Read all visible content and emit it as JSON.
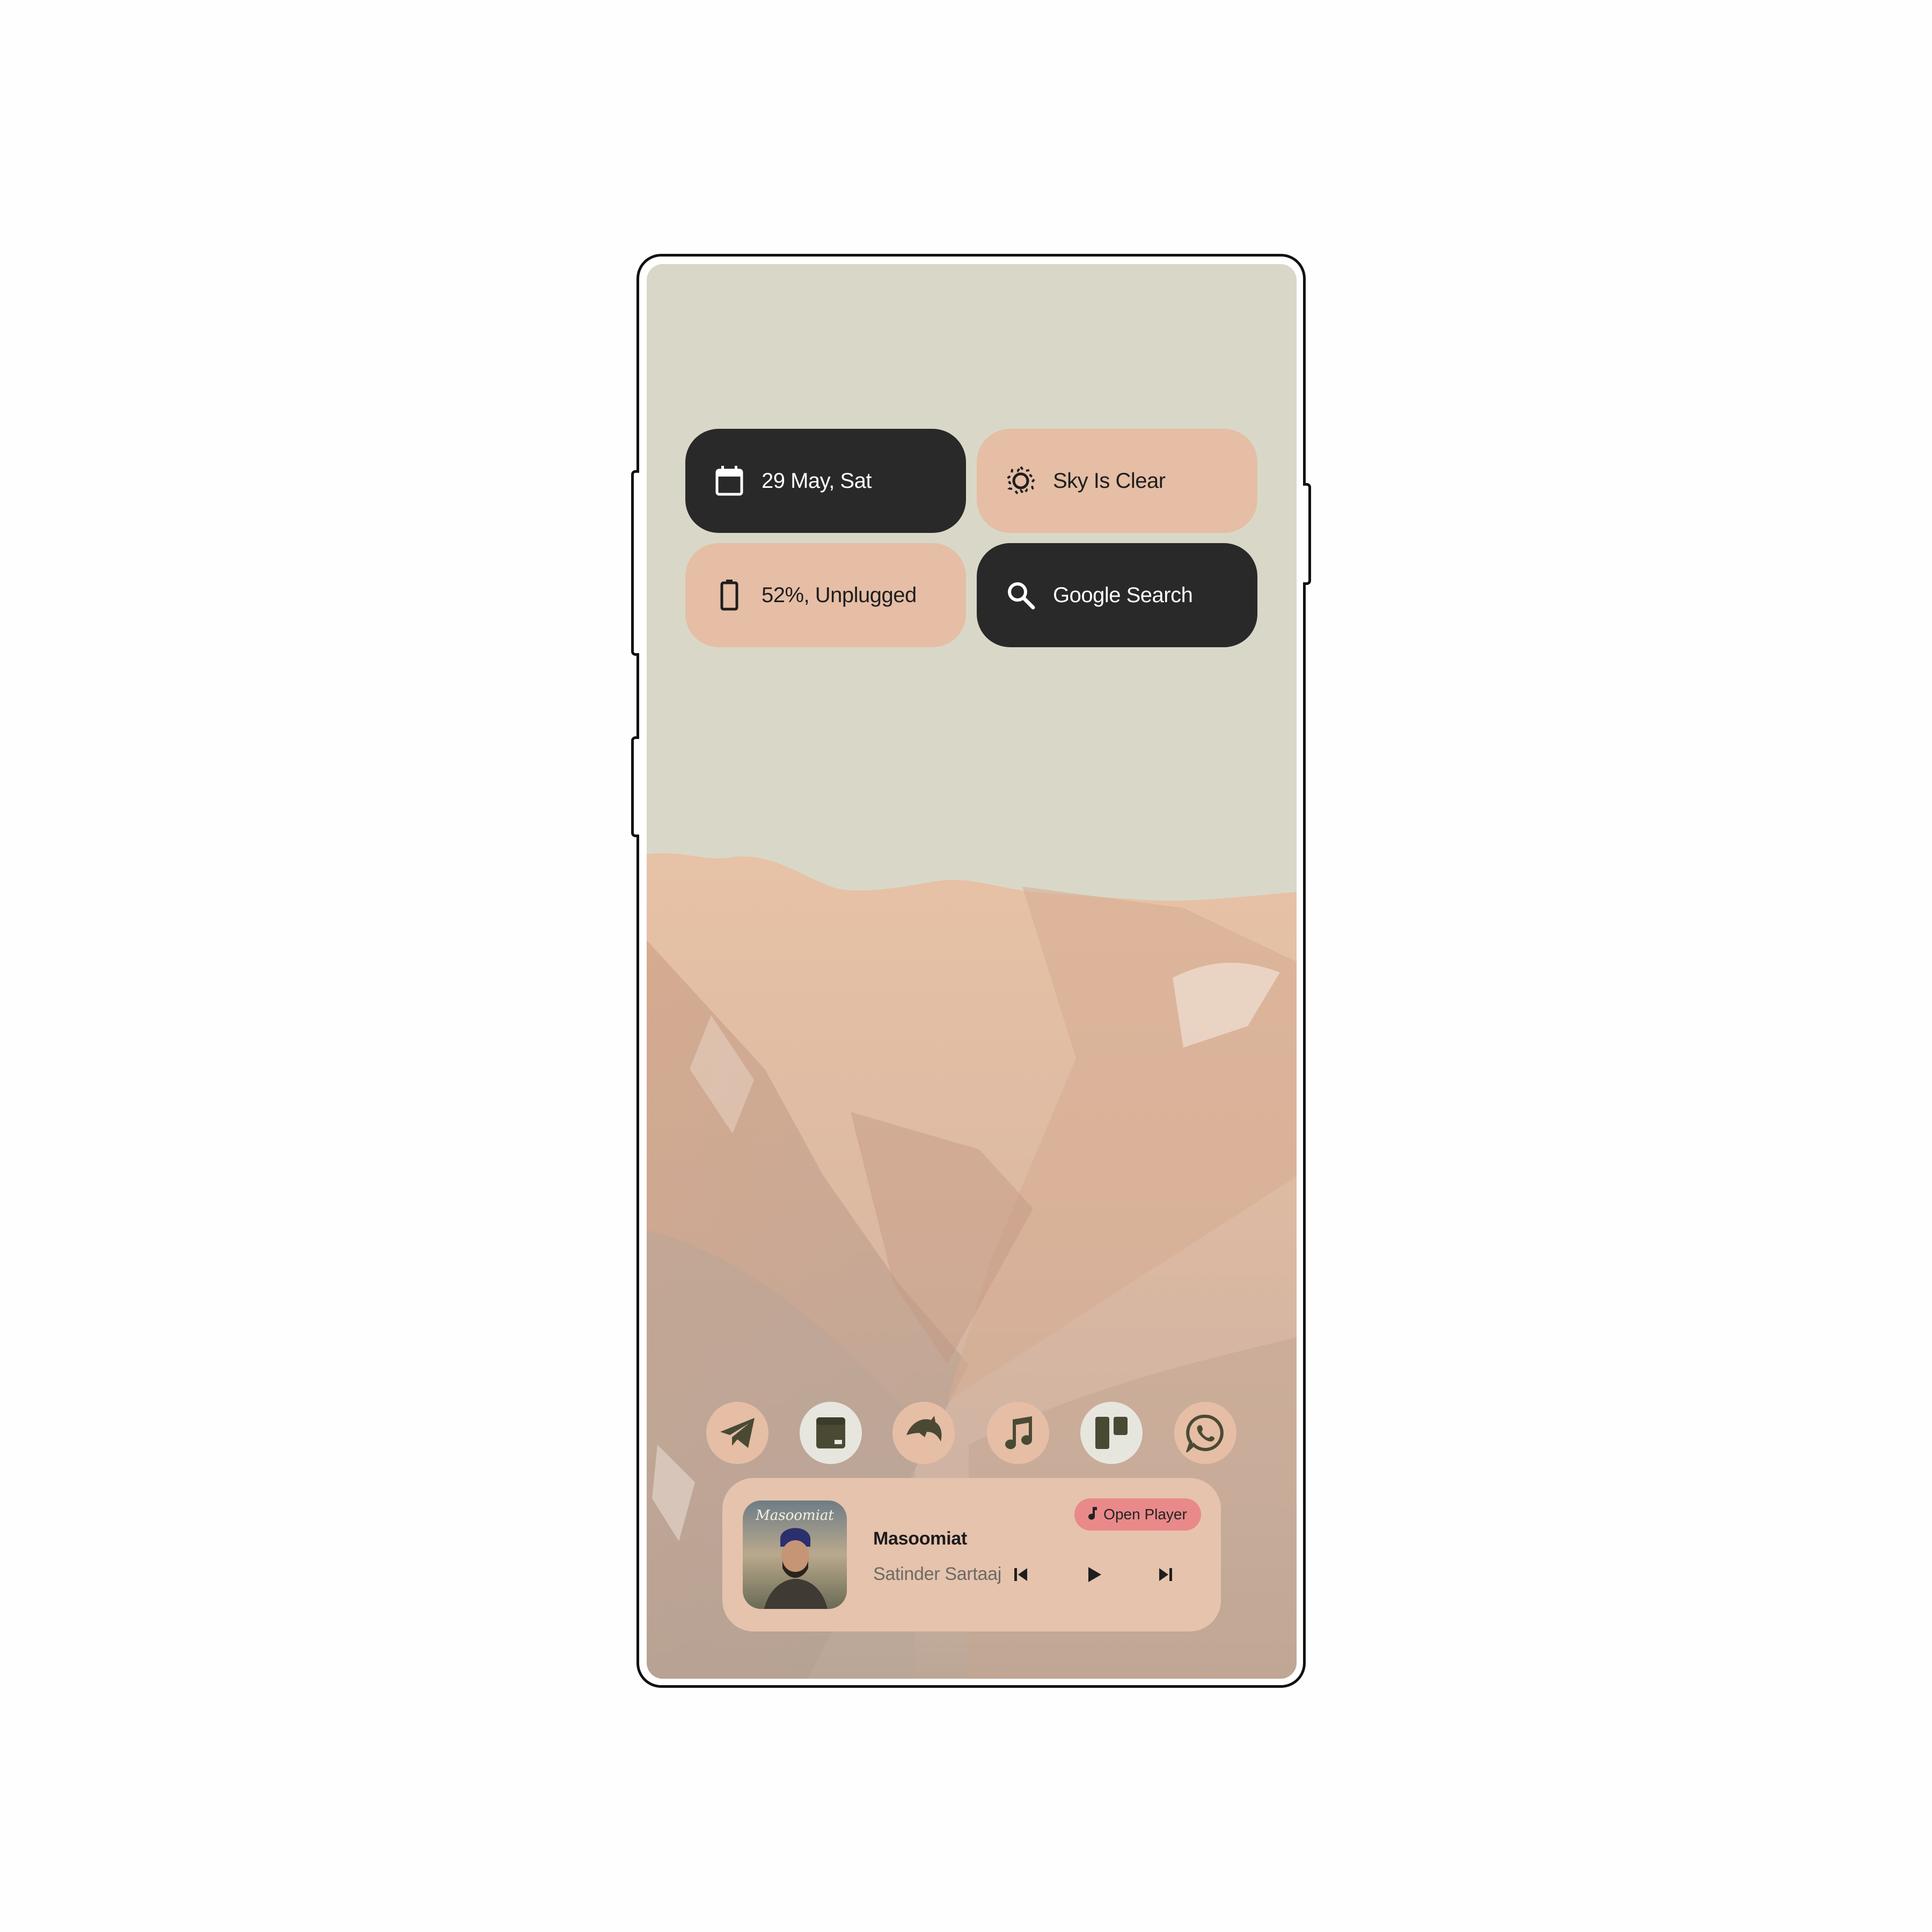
{
  "widgets": {
    "date": {
      "label": "29 May, Sat",
      "icon": "calendar-icon"
    },
    "weather": {
      "label": "Sky Is Clear",
      "icon": "brightness-icon"
    },
    "battery": {
      "label": "52%, Unplugged",
      "icon": "battery-icon"
    },
    "search": {
      "label": "Google Search",
      "icon": "search-icon"
    }
  },
  "dock": [
    {
      "icon": "telegram-icon"
    },
    {
      "icon": "notes-app-icon"
    },
    {
      "icon": "dolphin-icon"
    },
    {
      "icon": "music-note-icon"
    },
    {
      "icon": "trello-icon"
    },
    {
      "icon": "whatsapp-icon"
    }
  ],
  "player": {
    "title": "Masoomiat",
    "artist": "Satinder Sartaaj",
    "open_label": "Open Player",
    "cover_text": "Masoomiat"
  },
  "colors": {
    "dark_widget": "#292929",
    "peach_widget": "#e5bea5",
    "sky": "#d9d8c8",
    "open_player_pill": "#e9898a",
    "icon_dark": "#4a4a34"
  }
}
